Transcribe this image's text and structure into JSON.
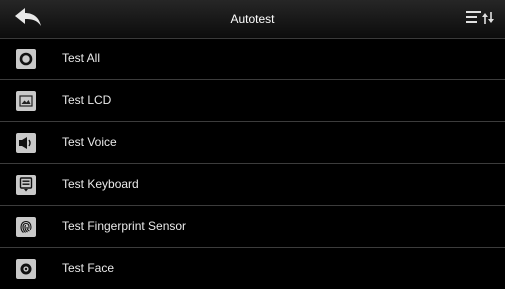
{
  "header": {
    "title": "Autotest",
    "back_icon": "back-arrow-icon",
    "sort_icon": "sort-menu-icon"
  },
  "menu": {
    "items": [
      {
        "label": "Test All",
        "icon": "circle-icon"
      },
      {
        "label": "Test LCD",
        "icon": "image-screen-icon"
      },
      {
        "label": "Test Voice",
        "icon": "speaker-icon"
      },
      {
        "label": "Test Keyboard",
        "icon": "keyboard-icon"
      },
      {
        "label": "Test Fingerprint Sensor",
        "icon": "fingerprint-icon"
      },
      {
        "label": "Test Face",
        "icon": "face-camera-icon"
      }
    ]
  },
  "colors": {
    "background": "#000000",
    "header": "#1a1a1a",
    "icon_tile": "#c9c9c9",
    "text": "#eaeaea",
    "divider": "#3c3c3c"
  }
}
